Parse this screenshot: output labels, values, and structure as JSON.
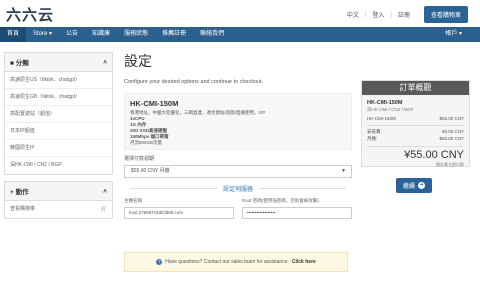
{
  "header": {
    "logo": "六六云",
    "language": "中文",
    "login": "登入",
    "register": "註冊",
    "cart_label": "查看購物車"
  },
  "nav": {
    "items": [
      "首頁",
      "Store ▾",
      "公告",
      "知識庫",
      "服務狀態",
      "推薦註冊",
      "聯絡我們"
    ],
    "account": "帳戶 ▾"
  },
  "sidebar": {
    "categories_title": "分類",
    "categories": [
      "高速原生US（tiktok、chatgpt）",
      "高速原生GB（tiktok、chatgpt）",
      "高配置建站（超值）",
      "日本IP超值",
      "韓國原生IP",
      "深HK-CMI / CN2 / BGP"
    ],
    "actions_title": "動作",
    "actions": [
      "查看購物車"
    ]
  },
  "main": {
    "title": "設定",
    "intro": "Configure your desired options and continue to checkout.",
    "product": {
      "name": "HK-CMI-150M",
      "desc": [
        "香港地址，中國大陸優化，三網直連，適合建站/遊戲/直播使用，1IP",
        "1vCPU",
        "1G 內存",
        "20G SSD高速硬盤",
        "150Mbps 端口帶寬",
        "月流800GB流量"
      ]
    },
    "billing_label": "選擇付款週期",
    "billing_value": "$55.00 CNY 月繳",
    "config_title": "設定伺服器",
    "hostname_label": "主機名稱",
    "hostname_value": "host.276697c53fcfd68.com",
    "root_label": "Root 密碼(使用強密碼，否則會被攻擊)",
    "root_value": "••••••••••••••••••",
    "help_text": "Have questions? Contact our sales team for assistance.",
    "help_link": "Click here"
  },
  "summary": {
    "title": "訂單概觀",
    "product_name": "HK-CMI-150M",
    "product_group": "深HK-CMI / CN2 / BGP",
    "line_label": "HK-CMI-150M",
    "line_value": "$55.00 CNY",
    "setup_label": "安裝費:",
    "setup_value": "¥0.00 CNY",
    "monthly_label": "月繳:",
    "monthly_value": "$55.00 CNY",
    "total": "¥55.00 CNY",
    "note": "總計應立即付款"
  },
  "continue_label": "繼續",
  "colors": {
    "nav_bg": "#2b5f8e",
    "button_bg": "#2a6496",
    "summary_head": "#595959",
    "help_bg": "#fcf8e3"
  }
}
